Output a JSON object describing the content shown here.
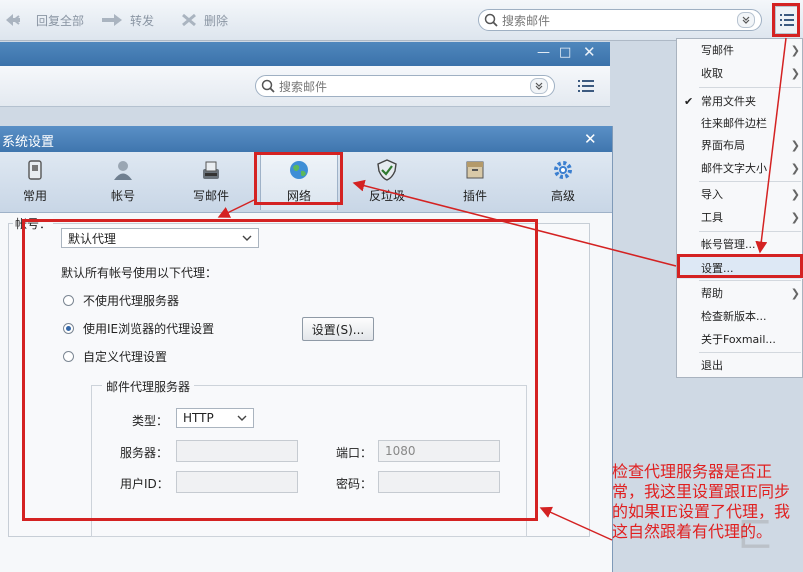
{
  "toolbar": {
    "reply_all": "回复全部",
    "forward": "转发",
    "delete": "删除",
    "search_placeholder": "搜索邮件"
  },
  "mail_window": {
    "search_placeholder": "搜索邮件"
  },
  "dialog": {
    "title": "系统设置",
    "tabs": [
      {
        "label": "常用",
        "icon": "general-icon"
      },
      {
        "label": "帐号",
        "icon": "account-icon"
      },
      {
        "label": "写邮件",
        "icon": "compose-icon"
      },
      {
        "label": "网络",
        "icon": "network-globe-icon"
      },
      {
        "label": "反垃圾",
        "icon": "antispam-shield-icon"
      },
      {
        "label": "插件",
        "icon": "plugin-icon"
      },
      {
        "label": "高级",
        "icon": "advanced-gear-icon"
      }
    ],
    "account_label": "帐号：",
    "account_value": "默认代理",
    "proxy_intro": "默认所有帐号使用以下代理：",
    "options": [
      "不使用代理服务器",
      "使用IE浏览器的代理设置",
      "自定义代理设置"
    ],
    "selected_option": 1,
    "settings_button": "设置(S)...",
    "proxy_group_title": "邮件代理服务器",
    "type_label": "类型：",
    "type_value": "HTTP",
    "server_label": "服务器：",
    "port_label": "端口：",
    "port_value": "1080",
    "user_label": "用户ID：",
    "password_label": "密码："
  },
  "menu": {
    "items": [
      "写邮件",
      "收取",
      "常用文件夹",
      "往来邮件边栏",
      "界面布局",
      "邮件文字大小",
      "导入",
      "工具",
      "帐号管理...",
      "设置...",
      "帮助",
      "检查新版本...",
      "关于Foxmail...",
      "退出"
    ]
  },
  "annotation": "检查代理服务器是否正常，我这里设置跟IE同步的如果IE设置了代理，我这自然跟着有代理的。",
  "watermark": "匚",
  "colors": {
    "highlight_red": "#d42222",
    "title_blue": "#4a82b9"
  }
}
